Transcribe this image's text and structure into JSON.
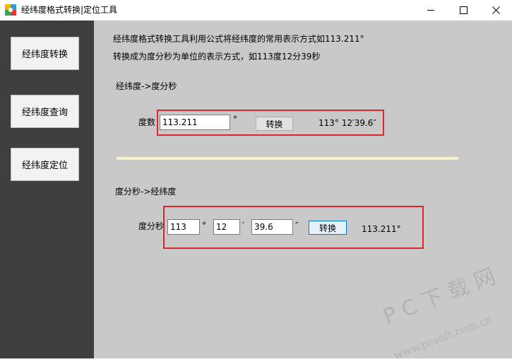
{
  "window": {
    "title": "经纬度格式转换|定位工具"
  },
  "sidebar": {
    "items": [
      {
        "label": "经纬度转换"
      },
      {
        "label": "经纬度查询"
      },
      {
        "label": "经纬度定位"
      }
    ]
  },
  "main": {
    "intro_line1": "经纬度格式转换工具利用公式将经纬度的常用表示方式如113.211°",
    "intro_line2": "转换成为度分秒为单位的表示方式，如113度12分39秒",
    "section1": {
      "title": "经纬度->度分秒",
      "field_label": "度数",
      "degrees_value": "113.211",
      "degree_symbol": "°",
      "convert_label": "转换",
      "result": "113° 12′39.6″"
    },
    "section2": {
      "title": "度分秒->经纬度",
      "field_label": "度分秒",
      "deg_value": "113",
      "deg_symbol": "°",
      "min_value": "12",
      "min_symbol": "′",
      "sec_value": "39.6",
      "sec_symbol": "″",
      "convert_label": "转换",
      "result": "113.211°"
    }
  },
  "watermark": {
    "line1": "P C 下 载 网",
    "line2": "www.pcsoft.com.cn"
  },
  "colors": {
    "sidebar": "#3f3f3f",
    "content": "#c9c9c9",
    "highlight": "#e0242b",
    "divider": "#f7f1c8"
  }
}
